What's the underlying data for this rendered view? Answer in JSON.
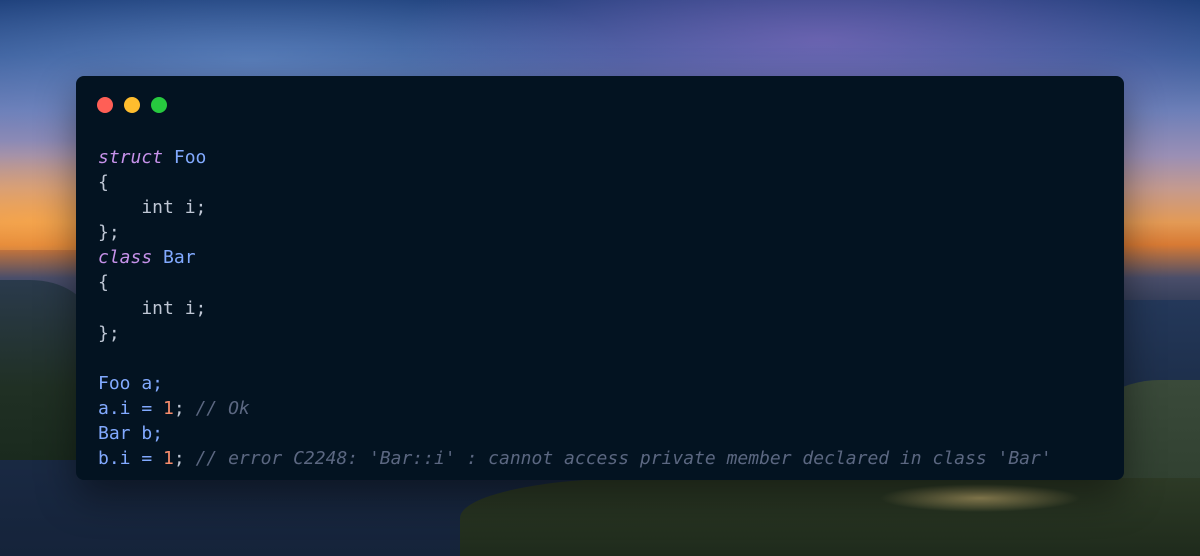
{
  "window": {
    "controls": [
      {
        "name": "close",
        "color": "#ff5f56"
      },
      {
        "name": "minimize",
        "color": "#ffbd2e"
      },
      {
        "name": "maximize",
        "color": "#27c93f"
      }
    ]
  },
  "theme": {
    "background": "#031321",
    "keyword": "#c792ea",
    "type": "#82aaff",
    "plain": "#bfc7d5",
    "number": "#f78c6c",
    "comment": "#5b6781"
  },
  "code": {
    "lines": [
      [
        {
          "t": "struct",
          "c": "kw"
        },
        {
          "t": " ",
          "c": "pl"
        },
        {
          "t": "Foo",
          "c": "ty"
        }
      ],
      [
        {
          "t": "{",
          "c": "pl"
        }
      ],
      [
        {
          "t": "    int i;",
          "c": "pl"
        }
      ],
      [
        {
          "t": "};",
          "c": "pl"
        }
      ],
      [
        {
          "t": "class",
          "c": "kw"
        },
        {
          "t": " ",
          "c": "pl"
        },
        {
          "t": "Bar",
          "c": "ty"
        }
      ],
      [
        {
          "t": "{",
          "c": "pl"
        }
      ],
      [
        {
          "t": "    int i;",
          "c": "pl"
        }
      ],
      [
        {
          "t": "};",
          "c": "pl"
        }
      ],
      [],
      [
        {
          "t": "Foo a;",
          "c": "ty"
        }
      ],
      [
        {
          "t": "a.i = ",
          "c": "ty"
        },
        {
          "t": "1",
          "c": "nm"
        },
        {
          "t": "; ",
          "c": "pl"
        },
        {
          "t": "// Ok",
          "c": "cm"
        }
      ],
      [
        {
          "t": "Bar b;",
          "c": "ty"
        }
      ],
      [
        {
          "t": "b.i = ",
          "c": "ty"
        },
        {
          "t": "1",
          "c": "nm"
        },
        {
          "t": "; ",
          "c": "pl"
        },
        {
          "t": "// error C2248: 'Bar::i' : cannot access private member declared in class 'Bar'",
          "c": "cm"
        }
      ]
    ]
  }
}
